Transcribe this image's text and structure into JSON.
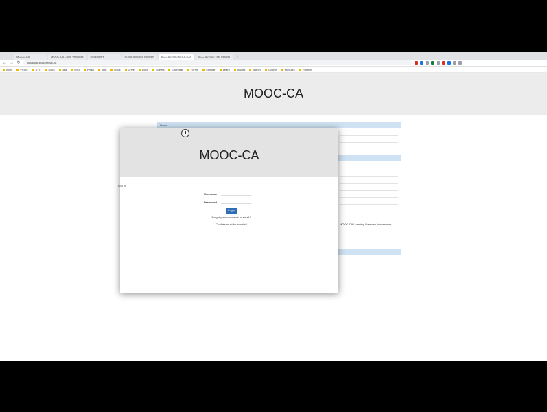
{
  "browser": {
    "tabs": [
      "MOOC-CA",
      "MOOC-CA Login Variables",
      "Developers",
      "Run Automated Browser",
      "ACC-IA/2000 MOOC-CA",
      "ACC-IA/2000 Test Results"
    ],
    "address": "localhost:8080/mooc-ca",
    "bookmarks": [
      "Apps",
      "VVBM",
      "SYS",
      "Docs",
      "Jira",
      "Wiki",
      "Portal",
      "Mail",
      "Docs",
      "Drive",
      "Docs",
      "Sheets",
      "Calendar",
      "Forms",
      "Scholar",
      "Learn",
      "Issues",
      "Admin",
      "Course",
      "Modules",
      "Projects"
    ]
  },
  "page": {
    "title": "MOOC-CA"
  },
  "background": {
    "bar1": "Home",
    "text": "MOOC-CA Learning Gateway Assessment"
  },
  "modal": {
    "title": "MOOC-CA",
    "side_text": "Log in",
    "username_label": "Username",
    "password_label": "Password",
    "login_button": "Login",
    "forgot_link": "Forgot your username or email?",
    "cookies_link": "Cookies must be enabled"
  },
  "colors": {
    "accent": "#2f6db5",
    "header_bg": "#e3e3e3",
    "panel_bar": "#cfe2f3"
  }
}
